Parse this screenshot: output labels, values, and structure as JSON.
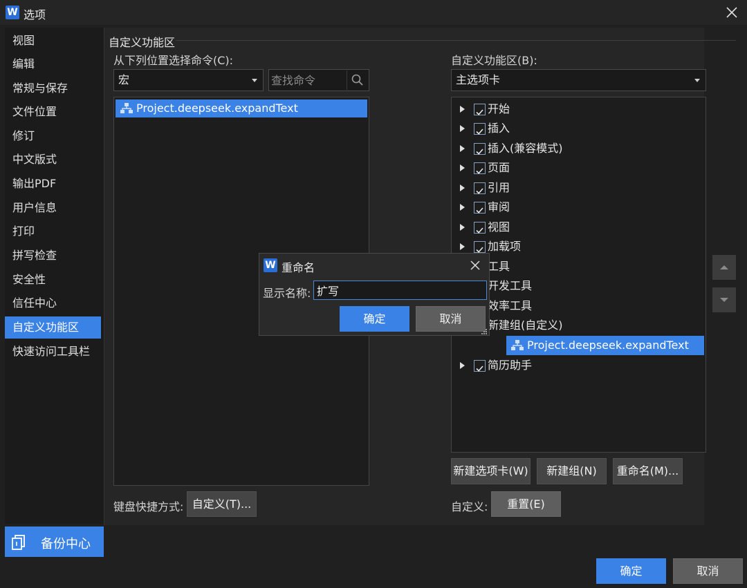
{
  "window": {
    "title": "选项",
    "logo": "W"
  },
  "sidebar": {
    "items": [
      {
        "label": "视图"
      },
      {
        "label": "编辑"
      },
      {
        "label": "常规与保存"
      },
      {
        "label": "文件位置"
      },
      {
        "label": "修订"
      },
      {
        "label": "中文版式"
      },
      {
        "label": "输出PDF"
      },
      {
        "label": "用户信息"
      },
      {
        "label": "打印"
      },
      {
        "label": "拼写检查"
      },
      {
        "label": "安全性"
      },
      {
        "label": "信任中心"
      },
      {
        "label": "自定义功能区",
        "active": true
      },
      {
        "label": "快速访问工具栏"
      }
    ],
    "backup_label": "备份中心"
  },
  "main": {
    "section_title": "自定义功能区",
    "left": {
      "label": "从下列位置选择命令(C):",
      "source_value": "宏",
      "search_placeholder": "查找命令",
      "commands": [
        {
          "label": "Project.deepseek.expandText",
          "selected": true
        }
      ],
      "keyboard_label": "键盘快捷方式:",
      "customize_btn": "自定义(T)..."
    },
    "right": {
      "label": "自定义功能区(B):",
      "tabs_value": "主选项卡",
      "tree": [
        {
          "label": "开始",
          "checked": true,
          "expandable": true
        },
        {
          "label": "插入",
          "checked": true,
          "expandable": true
        },
        {
          "label": "插入(兼容模式)",
          "checked": true,
          "expandable": true
        },
        {
          "label": "页面",
          "checked": true,
          "expandable": true
        },
        {
          "label": "引用",
          "checked": true,
          "expandable": true
        },
        {
          "label": "审阅",
          "checked": true,
          "expandable": true
        },
        {
          "label": "视图",
          "checked": true,
          "expandable": true
        },
        {
          "label": "加载项",
          "checked": true,
          "expandable": true
        },
        {
          "label": "工具",
          "checked": true,
          "expandable": true
        },
        {
          "label": "开发工具",
          "checked": true,
          "expandable": true
        },
        {
          "label": "效率工具",
          "checked": true,
          "expandable": true
        },
        {
          "label": "新建组(自定义)",
          "checked": true,
          "expandable": true
        },
        {
          "label": "Project.deepseek.expandText",
          "selected": true,
          "child": true
        },
        {
          "label": "简历助手",
          "checked": true,
          "expandable": true
        }
      ],
      "new_tab_btn": "新建选项卡(W)",
      "new_group_btn": "新建组(N)",
      "rename_btn": "重命名(M)...",
      "customize_label": "自定义:",
      "reset_btn": "重置(E)"
    }
  },
  "rename_dialog": {
    "title": "重命名",
    "field_label": "显示名称:",
    "field_value": "扩写",
    "ok": "确定",
    "cancel": "取消"
  },
  "footer": {
    "ok": "确定",
    "cancel": "取消"
  },
  "colors": {
    "accent": "#3a82e5",
    "background": "#202020"
  }
}
